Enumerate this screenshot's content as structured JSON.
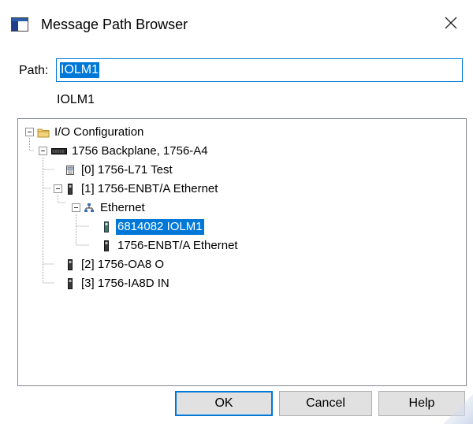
{
  "window": {
    "title": "Message Path Browser",
    "app_icon": "window-app-icon",
    "close_icon": "close-icon"
  },
  "path": {
    "label": "Path:",
    "value": "IOLM1",
    "resolved": "IOLM1"
  },
  "tree": {
    "nodes": [
      {
        "label": "I/O Configuration",
        "icon": "folder-icon",
        "expanded": true
      },
      {
        "label": "1756 Backplane, 1756-A4",
        "icon": "backplane-icon",
        "expanded": true
      },
      {
        "label": "[0] 1756-L71 Test",
        "icon": "controller-icon"
      },
      {
        "label": "[1] 1756-ENBT/A Ethernet",
        "icon": "module-icon",
        "expanded": true
      },
      {
        "label": "Ethernet",
        "icon": "network-icon",
        "expanded": true
      },
      {
        "label": "6814082 IOLM1",
        "icon": "module-icon",
        "selected": true
      },
      {
        "label": "1756-ENBT/A Ethernet",
        "icon": "module-icon"
      },
      {
        "label": "[2] 1756-OA8 O",
        "icon": "module-icon"
      },
      {
        "label": "[3] 1756-IA8D IN",
        "icon": "module-icon"
      }
    ]
  },
  "buttons": {
    "ok": "OK",
    "cancel": "Cancel",
    "help": "Help"
  },
  "colors": {
    "selection": "#0078d7",
    "button_face": "#e1e1e1",
    "tree_border": "#828790"
  }
}
